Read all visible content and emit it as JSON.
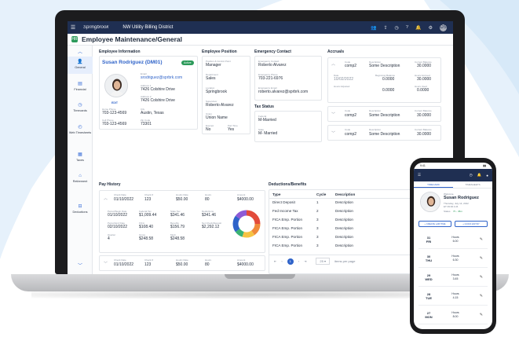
{
  "app": {
    "logo_text": "Springbrook",
    "district": "NW Utility Billing District",
    "avatar_initials": "DS",
    "page_title": "Employee Maintenance/General",
    "title_icon": "HR"
  },
  "sidebar": {
    "items": [
      {
        "label": "General",
        "icon": "person-icon"
      },
      {
        "label": "Financial",
        "icon": "financial-icon"
      },
      {
        "label": "Timecards",
        "icon": "clock-icon"
      },
      {
        "label": "Web Timesheets",
        "icon": "timesheet-icon"
      },
      {
        "label": "Taxes",
        "icon": "taxes-icon"
      },
      {
        "label": "Retirement",
        "icon": "retirement-icon"
      },
      {
        "label": "Deductions",
        "icon": "deductions-icon"
      }
    ]
  },
  "employee_info": {
    "heading": "Employee Information",
    "name": "Susan Rodriguez (DM01)",
    "status": "Active",
    "edit": "EDIT",
    "email_label": "Email",
    "email": "srodriguez@sprbrk.com",
    "address1_label": "Address 1",
    "address1": "7426 Colshire Drive",
    "address2_label": "Address 2",
    "address2": "7426 Colshire Drive",
    "home_phone_label": "Home Phone",
    "home_phone": "703-123-4569",
    "city_label": "City",
    "city": "Austin, Texas",
    "cell_phone_label": "Cell Phone",
    "cell_phone": "703-123-4569",
    "zip_label": "Zip Code",
    "zip": "73301"
  },
  "employee_position": {
    "heading": "Employee Position",
    "position_label": "Position & Control Point",
    "position": "Manager",
    "department_label": "Department",
    "department": "Sales",
    "location_label": "Location",
    "location": "Springbrook",
    "supervisor_label": "Supervisor",
    "supervisor": "Roberto Alvarez",
    "union_label": "Union",
    "union": "Union Name",
    "exempt_label": "Exempt",
    "exempt": "No",
    "parttime_label": "Part Time",
    "parttime": "Yes"
  },
  "emergency_contact": {
    "heading": "Emergency Contact",
    "contact_label": "Emergency Contact",
    "contact": "Roberto Alvarez",
    "phone_label": "Emergency Phone",
    "phone": "703-221-6976",
    "email_label": "Emergency Email",
    "email": "roberto.alvarez@sprbrk.com"
  },
  "tax_status": {
    "heading": "Tax Status",
    "federal_label": "Federal",
    "federal": "M-Married",
    "state_label": "State",
    "state": "M- Married"
  },
  "accruals": {
    "heading": "Accruals",
    "code_label": "Code",
    "code": "comp2",
    "description_label": "Description",
    "description": "Some  Description",
    "current_balance_label": "Current Balance",
    "current_balance": "30.0000",
    "date_label": "Date",
    "date": "10/02/2022",
    "beginning_balance_label": "Beginning Balance",
    "beginning_balance": "0.0000",
    "hours_accrued_label": "Hours Accrued",
    "hours_accrued": "30.0000",
    "hours_adjusted_label": "Hours Adjusted",
    "hours_adjusted": "0.0000",
    "hours_used_label": "Hours Used",
    "hours_used": "0.0000",
    "collapsed_rows": [
      {
        "code": "comp2",
        "description": "Some  Description",
        "balance": "30.0000"
      },
      {
        "code": "comp2",
        "description": "Some  Description",
        "balance": "30.0000"
      }
    ]
  },
  "pay_history": {
    "heading": "Pay History",
    "check_date_label": "Check Date",
    "check_date": "01/10/2022",
    "check_no_label": "Check #",
    "check_no": "123",
    "hourly_rate_label": "Hourly Rate",
    "hourly_rate": "$50.00",
    "hours_label": "Hours",
    "hours": "80",
    "amount_label": "Amount",
    "amount": "$4000.00",
    "period_begin_label": "Period Begin Date",
    "period_begin": "01/10/2022",
    "federal_tax_label": "Federal Tax",
    "federal_tax": "$1,009.44",
    "state_tax_label": "State Tax",
    "state_tax": "$341.46",
    "deductions_label": "Deductions",
    "deductions": "$341.46",
    "period_end_label": "Period End Date",
    "period_end": "02/10/2022",
    "fica_label": "FICA",
    "fica": "$108.40",
    "benefits_label": "Benefits",
    "benefits": "$156.79",
    "net_label": "Net Check/Deposit",
    "net": "$2,292.12",
    "quarter_label": "Quarter",
    "quarter": "4",
    "gross_label": "Gross",
    "gross": "$248.58",
    "medi_label": "Medi",
    "medi": "$248.58",
    "second": {
      "check_date": "01/10/2022",
      "check_no": "123",
      "hourly_rate": "$50.00",
      "hours": "80",
      "amount": "$4000.00"
    },
    "donut_colors": [
      "#e24b3b",
      "#f08a3c",
      "#f6c343",
      "#3bb273",
      "#2f63c9",
      "#8e5bd6"
    ],
    "donut_shares": [
      0.25,
      0.15,
      0.15,
      0.1,
      0.2,
      0.15
    ]
  },
  "deductions_benefits": {
    "heading": "Deductions/Benefits",
    "columns": [
      "Type",
      "Cycle",
      "Description"
    ],
    "rows": [
      [
        "Direct Deposit",
        "1",
        "Description"
      ],
      [
        "Fed Income Tax",
        "2",
        "Description"
      ],
      [
        "FICA Emp. Portion",
        "3",
        "Description"
      ],
      [
        "FICA Emp. Portion",
        "3",
        "Description"
      ],
      [
        "FICA Emp. Portion",
        "3",
        "Description"
      ],
      [
        "FICA Emp. Portion",
        "3",
        "Description"
      ]
    ],
    "current_page": "1",
    "page_size": "25",
    "items_per_page": "items per page"
  },
  "phone": {
    "time": "9:41",
    "tab_timecard": "TIMECARD",
    "tab_timesheets": "TIMESHEETS",
    "welcome": "Welcome,",
    "name": "Susan Rodriguez",
    "date": "Thursday, July 14, 2022",
    "time_in": "ET 09:00 A.M.",
    "status_label": "Status",
    "status_value": "7h - 45m",
    "btn_timecard": "+ CREATE LAB TIME",
    "btn_entry": "+ QUICK ENTRY",
    "hours_label": "Hours",
    "days": [
      {
        "num": "31",
        "day": "FRI",
        "hours": "6.00"
      },
      {
        "num": "30",
        "day": "THU",
        "hours": "6.30"
      },
      {
        "num": "29",
        "day": "WED",
        "hours": "3.45"
      },
      {
        "num": "28",
        "day": "TUE",
        "hours": "4.15"
      },
      {
        "num": "27",
        "day": "MON",
        "hours": "8.00"
      }
    ]
  }
}
